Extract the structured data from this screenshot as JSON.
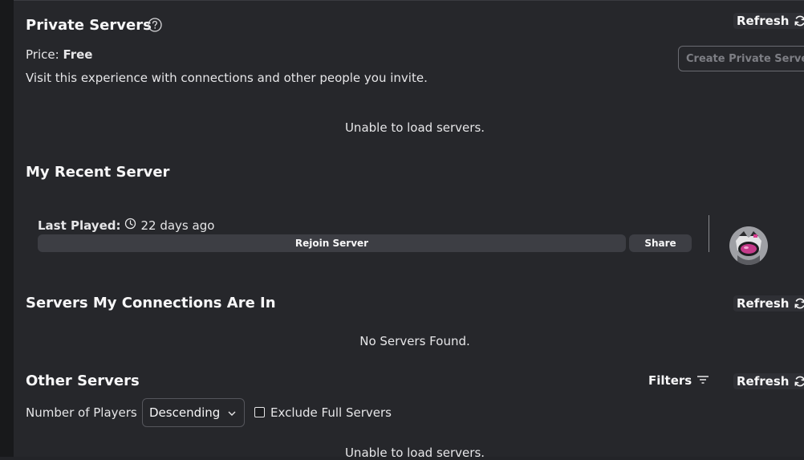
{
  "private_servers": {
    "title": "Private Servers",
    "refresh_label": "Refresh",
    "price_label": "Price:",
    "price_value": "Free",
    "description": "Visit this experience with connections and other people you invite.",
    "create_label": "Create Private Server",
    "status": "Unable to load servers."
  },
  "recent_server": {
    "title": "My Recent Server",
    "last_played_label": "Last Played:",
    "last_played_value": "22 days ago",
    "rejoin_label": "Rejoin Server",
    "share_label": "Share"
  },
  "connections_servers": {
    "title": "Servers My Connections Are In",
    "refresh_label": "Refresh",
    "status": "No Servers Found."
  },
  "other_servers": {
    "title": "Other Servers",
    "filters_label": "Filters",
    "refresh_label": "Refresh",
    "sort_label": "Number of Players",
    "sort_value": "Descending",
    "exclude_full_label": "Exclude Full Servers",
    "exclude_full_checked": false,
    "status": "Unable to load servers."
  },
  "icons": {
    "help": "question-circle-icon",
    "refresh": "refresh-icon",
    "clock": "clock-icon",
    "filter": "filter-icon",
    "chevron": "chevron-down-icon"
  }
}
